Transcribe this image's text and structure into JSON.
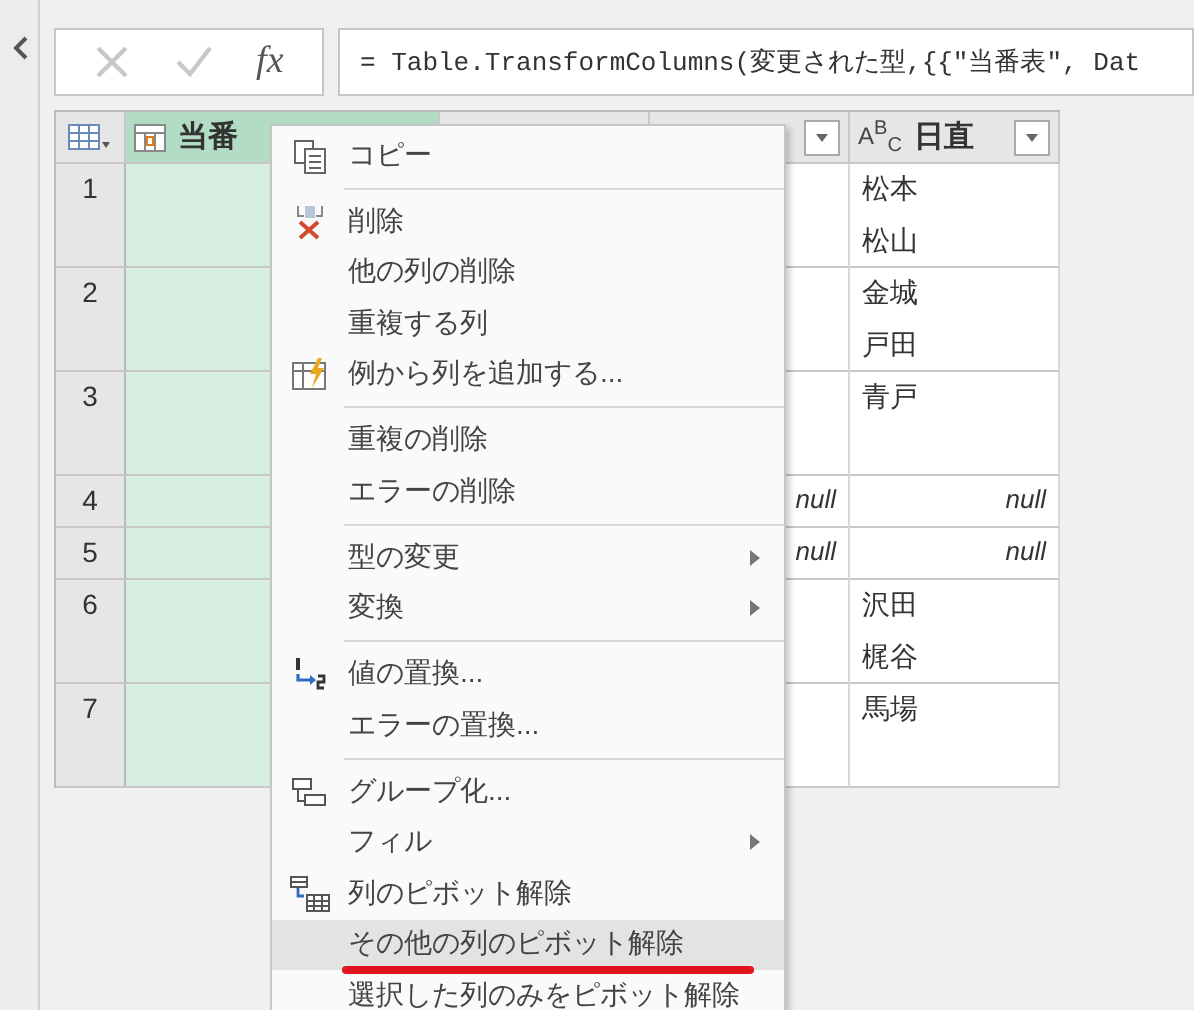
{
  "formula_bar": {
    "cancel_disabled": true,
    "confirm_disabled": true,
    "fx_label": "fx",
    "formula": "= Table.TransformColumns(変更された型,{{\"当番表\", Dat"
  },
  "table": {
    "columns": [
      {
        "kind": "table",
        "label": "当番",
        "selected": true
      },
      {
        "kind": "blank",
        "selected": false
      },
      {
        "kind": "blank",
        "selected": false,
        "dropdown": true
      },
      {
        "kind": "text",
        "label": "日直",
        "type_badge": "A$^{B}$$_{C}$",
        "selected": false,
        "dropdown": true
      }
    ],
    "rows": [
      {
        "number": "1",
        "tall": true,
        "null_value": false,
        "day_duty": [
          "松本",
          "松山"
        ]
      },
      {
        "number": "2",
        "tall": true,
        "null_value": false,
        "day_duty": [
          "金城",
          "戸田"
        ]
      },
      {
        "number": "3",
        "tall": true,
        "null_value": false,
        "day_duty": [
          "青戸"
        ]
      },
      {
        "number": "4",
        "tall": false,
        "null_value": true,
        "column_3": "null",
        "day_duty": [
          "null"
        ]
      },
      {
        "number": "5",
        "tall": false,
        "null_value": true,
        "column_3": "null",
        "day_duty": [
          "null"
        ]
      },
      {
        "number": "6",
        "tall": true,
        "null_value": false,
        "day_duty": [
          "沢田",
          "梶谷"
        ]
      },
      {
        "number": "7",
        "tall": true,
        "null_value": false,
        "day_duty": [
          "馬場"
        ]
      }
    ]
  },
  "context_menu": {
    "items": [
      {
        "kind": "item",
        "label": "コピー",
        "selected": false
      },
      {
        "kind": "separator"
      },
      {
        "kind": "item",
        "label": "削除",
        "selected": false
      },
      {
        "kind": "item",
        "label": "他の列の削除",
        "selected": false
      },
      {
        "kind": "item",
        "label": "重複する列",
        "selected": false
      },
      {
        "kind": "item",
        "label": "例から列を追加する...",
        "selected": false
      },
      {
        "kind": "separator"
      },
      {
        "kind": "item",
        "label": "重複の削除",
        "selected": false
      },
      {
        "kind": "item",
        "label": "エラーの削除",
        "selected": false
      },
      {
        "kind": "separator"
      },
      {
        "kind": "item",
        "label": "型の変更",
        "submenu": true,
        "selected": false
      },
      {
        "kind": "item",
        "label": "変換",
        "submenu": true,
        "selected": false
      },
      {
        "kind": "separator"
      },
      {
        "kind": "item",
        "label": "値の置換...",
        "selected": false
      },
      {
        "kind": "item",
        "label": "エラーの置換...",
        "selected": false
      },
      {
        "kind": "separator"
      },
      {
        "kind": "item",
        "label": "グループ化...",
        "selected": false
      },
      {
        "kind": "item",
        "label": "フィル",
        "submenu": true,
        "selected": false
      },
      {
        "kind": "item",
        "label": "列のピボット解除",
        "selected": false
      },
      {
        "kind": "item",
        "label": "その他の列のピボット解除",
        "selected": true,
        "underlined": true
      },
      {
        "kind": "item",
        "label": "選択した列のみをピボット解除",
        "selected": false
      }
    ]
  }
}
